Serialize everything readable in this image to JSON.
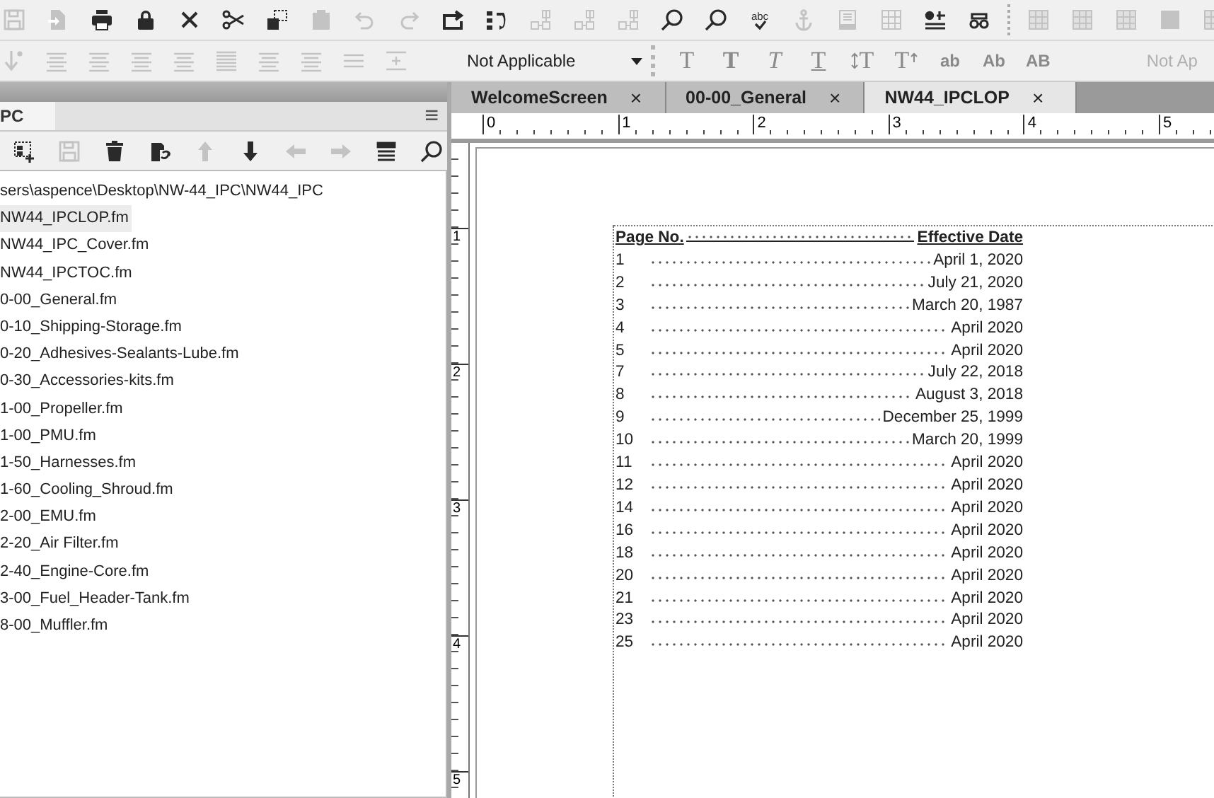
{
  "toolbar": [
    {
      "kind": "save",
      "disabled": true
    },
    {
      "kind": "import",
      "disabled": true
    },
    {
      "kind": "print",
      "disabled": false
    },
    {
      "kind": "lock",
      "disabled": false
    },
    {
      "kind": "close",
      "disabled": false
    },
    {
      "kind": "cut",
      "disabled": false
    },
    {
      "kind": "copy",
      "disabled": false
    },
    {
      "kind": "paste",
      "disabled": true
    },
    {
      "kind": "undo",
      "disabled": true
    },
    {
      "kind": "redo",
      "disabled": true
    },
    {
      "kind": "repeat",
      "disabled": false
    },
    {
      "kind": "sort",
      "disabled": false
    },
    {
      "kind": "link",
      "disabled": true
    },
    {
      "kind": "link",
      "disabled": true
    },
    {
      "kind": "link",
      "disabled": true
    },
    {
      "kind": "find",
      "disabled": false
    },
    {
      "kind": "find",
      "disabled": false
    },
    {
      "kind": "spell",
      "disabled": false,
      "label": "abc"
    },
    {
      "kind": "anchor",
      "disabled": true
    },
    {
      "kind": "frame",
      "disabled": true
    },
    {
      "kind": "table",
      "disabled": true
    },
    {
      "kind": "variable",
      "disabled": false
    },
    {
      "kind": "glasses",
      "disabled": false
    },
    {
      "kind": "grid",
      "disabled": true
    },
    {
      "kind": "grid",
      "disabled": true
    },
    {
      "kind": "grid",
      "disabled": true
    },
    {
      "kind": "block",
      "disabled": true
    },
    {
      "kind": "grid",
      "disabled": true
    }
  ],
  "format_bar": {
    "left": [
      {
        "kind": "arrow-down",
        "disabled": true
      },
      {
        "kind": "align",
        "disabled": true
      },
      {
        "kind": "align",
        "disabled": true
      },
      {
        "kind": "align",
        "disabled": true
      },
      {
        "kind": "align",
        "disabled": true
      },
      {
        "kind": "align-dense",
        "disabled": true
      },
      {
        "kind": "align",
        "disabled": true
      },
      {
        "kind": "align",
        "disabled": true
      },
      {
        "kind": "align-sparse",
        "disabled": true
      },
      {
        "kind": "align-plus",
        "disabled": true
      }
    ],
    "dropdown": "Not Applicable",
    "text_styles": [
      {
        "kind": "plain",
        "label": "T",
        "disabled": true
      },
      {
        "kind": "bold",
        "label": "T",
        "disabled": true
      },
      {
        "kind": "italic",
        "label": "T",
        "disabled": true
      },
      {
        "kind": "underline",
        "label": "T",
        "disabled": true
      },
      {
        "kind": "changebar",
        "label": "T",
        "disabled": true
      },
      {
        "kind": "superscript",
        "label": "T",
        "disabled": true
      },
      {
        "kind": "sans",
        "label": "ab",
        "disabled": true
      },
      {
        "kind": "sans",
        "label": "Ab",
        "disabled": true
      },
      {
        "kind": "sans",
        "label": "AB",
        "disabled": true
      }
    ],
    "dropdown_2": "Not Ap"
  },
  "panel": {
    "tab": "PC",
    "menu_glyph": "≡",
    "toolbar": [
      {
        "kind": "add",
        "disabled": false
      },
      {
        "kind": "save",
        "disabled": true
      },
      {
        "kind": "trash",
        "disabled": false
      },
      {
        "kind": "refresh",
        "disabled": false
      },
      {
        "kind": "up",
        "disabled": true
      },
      {
        "kind": "down",
        "disabled": false
      },
      {
        "kind": "left",
        "disabled": true
      },
      {
        "kind": "right",
        "disabled": true
      },
      {
        "kind": "list",
        "disabled": false
      },
      {
        "kind": "search",
        "disabled": false
      }
    ],
    "path": "sers\\aspence\\Desktop\\NW-44_IPC\\NW44_IPC",
    "files": [
      {
        "name": "NW44_IPCLOP.fm",
        "selected": true
      },
      {
        "name": "NW44_IPC_Cover.fm",
        "selected": false
      },
      {
        "name": "NW44_IPCTOC.fm",
        "selected": false
      },
      {
        "name": "0-00_General.fm",
        "selected": false
      },
      {
        "name": "0-10_Shipping-Storage.fm",
        "selected": false
      },
      {
        "name": "0-20_Adhesives-Sealants-Lube.fm",
        "selected": false
      },
      {
        "name": "0-30_Accessories-kits.fm",
        "selected": false
      },
      {
        "name": "1-00_Propeller.fm",
        "selected": false
      },
      {
        "name": "1-00_PMU.fm",
        "selected": false
      },
      {
        "name": "1-50_Harnesses.fm",
        "selected": false
      },
      {
        "name": "1-60_Cooling_Shroud.fm",
        "selected": false
      },
      {
        "name": "2-00_EMU.fm",
        "selected": false
      },
      {
        "name": "2-20_Air Filter.fm",
        "selected": false
      },
      {
        "name": "2-40_Engine-Core.fm",
        "selected": false
      },
      {
        "name": "3-00_Fuel_Header-Tank.fm",
        "selected": false
      },
      {
        "name": "8-00_Muffler.fm",
        "selected": false
      }
    ]
  },
  "doc_tabs": [
    {
      "label": "WelcomeScreen",
      "close": "×",
      "selected": false
    },
    {
      "label": "00-00_General",
      "close": "×",
      "selected": false
    },
    {
      "label": "NW44_IPCLOP",
      "close": "×",
      "selected": true
    }
  ],
  "ruler": [
    "0",
    "1",
    "2",
    "3",
    "4",
    "5"
  ],
  "vertical_ruler": [
    "1",
    "2",
    "3",
    "4",
    "5"
  ],
  "document": {
    "header": {
      "left": "Page No.",
      "right": "Effective Date"
    },
    "rows": [
      {
        "page": "1",
        "date": "April 1, 2020"
      },
      {
        "page": "2",
        "date": "July 21, 2020"
      },
      {
        "page": "3",
        "date": "March 20, 1987"
      },
      {
        "page": "4",
        "date": "April 2020"
      },
      {
        "page": "5",
        "date": "April 2020"
      },
      {
        "page": "7",
        "date": "July 22, 2018"
      },
      {
        "page": "8",
        "date": "August 3, 2018"
      },
      {
        "page": "9",
        "date": "December 25, 1999"
      },
      {
        "page": "10",
        "date": "March 20, 1999"
      },
      {
        "page": "11",
        "date": "April 2020"
      },
      {
        "page": "12",
        "date": "April 2020"
      },
      {
        "page": "14",
        "date": "April 2020"
      },
      {
        "page": "16",
        "date": "April 2020"
      },
      {
        "page": "18",
        "date": "April 2020"
      },
      {
        "page": "20",
        "date": "April 2020"
      },
      {
        "page": "21",
        "date": "April 2020"
      },
      {
        "page": "23",
        "date": "April 2020"
      },
      {
        "page": "25",
        "date": "April 2020"
      }
    ]
  }
}
